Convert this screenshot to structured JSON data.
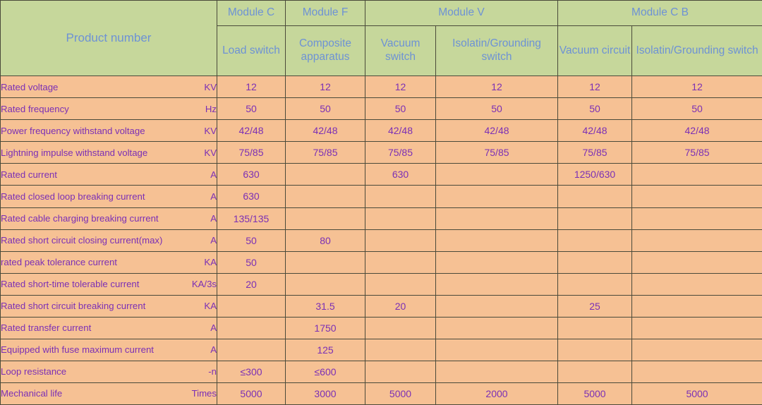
{
  "table": {
    "title_cell": "Product number",
    "module_groups": [
      {
        "label": "Module C",
        "span": 1
      },
      {
        "label": "Module F",
        "span": 1
      },
      {
        "label": "Module V",
        "span": 2
      },
      {
        "label": "Module C B",
        "span": 2
      }
    ],
    "sub_headers": [
      "Load switch",
      "Composite apparatus",
      "Vacuum switch",
      "Isolatin/Grounding switch",
      "Vacuum circuit",
      "Isolatin/Grounding switch"
    ],
    "rows": [
      {
        "name": "Rated voltage",
        "unit": "KV",
        "values": [
          "12",
          "12",
          "12",
          "12",
          "12",
          "12"
        ]
      },
      {
        "name": "Rated frequency",
        "unit": "Hz",
        "values": [
          "50",
          "50",
          "50",
          "50",
          "50",
          "50"
        ]
      },
      {
        "name": "Power frequency withstand voltage",
        "unit": "KV",
        "values": [
          "42/48",
          "42/48",
          "42/48",
          "42/48",
          "42/48",
          "42/48"
        ]
      },
      {
        "name": "Lightning impulse withstand voltage",
        "unit": "KV",
        "values": [
          "75/85",
          "75/85",
          "75/85",
          "75/85",
          "75/85",
          "75/85"
        ]
      },
      {
        "name": "Rated current",
        "unit": "A",
        "values": [
          "630",
          "",
          "630",
          "",
          "1250/630",
          ""
        ]
      },
      {
        "name": "Rated closed loop breaking current",
        "unit": "A",
        "values": [
          "630",
          "",
          "",
          "",
          "",
          ""
        ]
      },
      {
        "name": "Rated cable charging breaking current",
        "unit": "A",
        "values": [
          "135/135",
          "",
          "",
          "",
          "",
          ""
        ]
      },
      {
        "name": "Rated short circuit closing current(max)",
        "unit": "A",
        "values": [
          "50",
          "80",
          "",
          "",
          "",
          ""
        ]
      },
      {
        "name": "rated peak tolerance current",
        "unit": "KA",
        "values": [
          "50",
          "",
          "",
          "",
          "",
          ""
        ]
      },
      {
        "name": "Rated short-time tolerable current",
        "unit": "KA/3s",
        "values": [
          "20",
          "",
          "",
          "",
          "",
          ""
        ]
      },
      {
        "name": "Rated short circuit breaking current",
        "unit": "KA",
        "values": [
          "",
          "31.5",
          "20",
          "",
          "25",
          ""
        ]
      },
      {
        "name": "Rated transfer current",
        "unit": "A",
        "values": [
          "",
          "1750",
          "",
          "",
          "",
          ""
        ]
      },
      {
        "name": "Equipped with fuse maximum current",
        "unit": "A",
        "values": [
          "",
          "125",
          "",
          "",
          "",
          ""
        ]
      },
      {
        "name": "Loop resistance",
        "unit": "-n",
        "values": [
          "≤300",
          "≤600",
          "",
          "",
          "",
          ""
        ]
      },
      {
        "name": "Mechanical life",
        "unit": "Times",
        "values": [
          "5000",
          "3000",
          "5000",
          "2000",
          "5000",
          "5000"
        ]
      }
    ]
  },
  "colors": {
    "header_bg": "#c6d79b",
    "header_text": "#6d92d5",
    "cell_bg": "#f6c194",
    "cell_text": "#7b2fb5",
    "border": "#4a4a3a"
  }
}
